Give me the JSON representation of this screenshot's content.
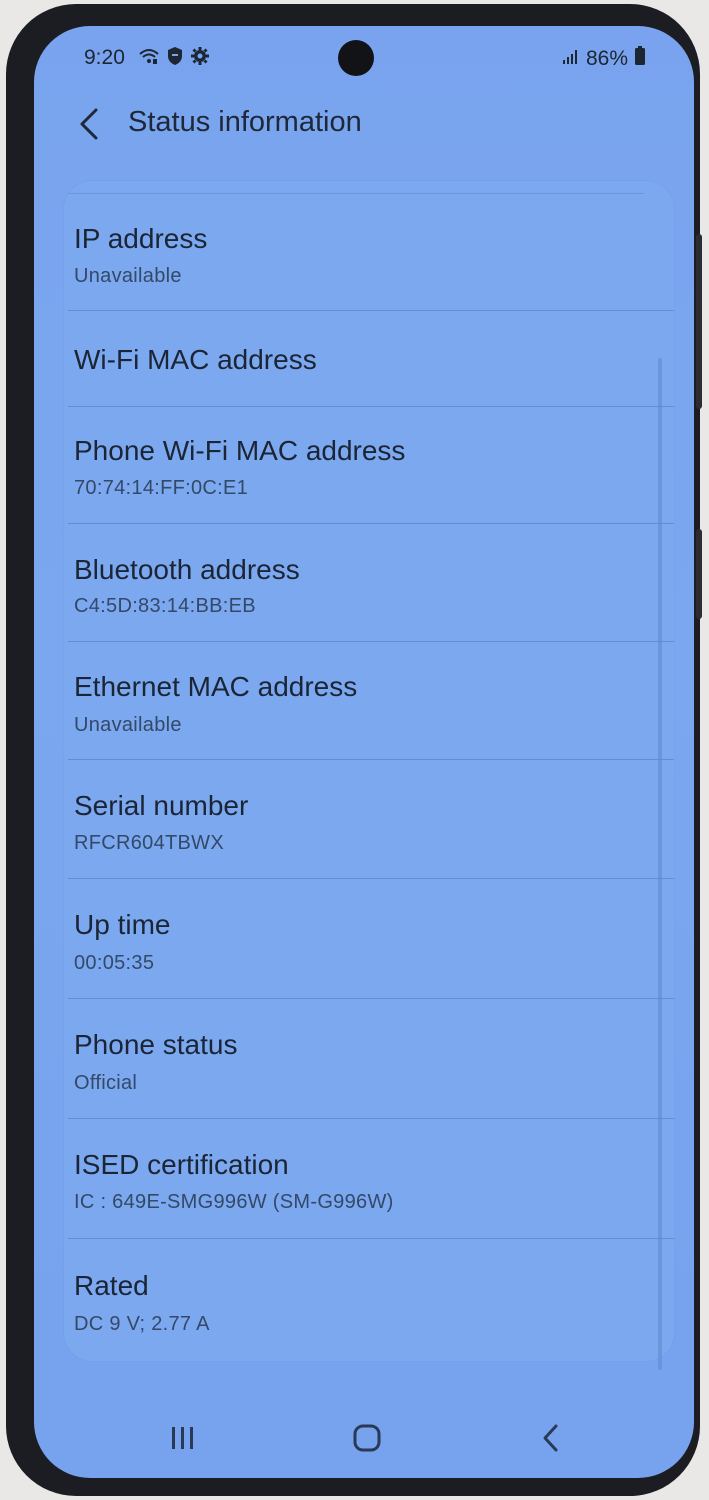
{
  "status_bar": {
    "time": "9:20",
    "battery": "86%",
    "icons": [
      "wifi-calling-icon",
      "shield-icon",
      "gear-icon"
    ],
    "right_icons": [
      "signal-icon",
      "battery-icon"
    ]
  },
  "app_bar": {
    "title": "Status information",
    "back_icon": "chevron-left-icon"
  },
  "items": [
    {
      "title": "IP address",
      "subtitle": "Unavailable"
    },
    {
      "title": "Wi-Fi MAC address",
      "subtitle": ""
    },
    {
      "title": "Phone Wi-Fi MAC address",
      "subtitle": "70:74:14:FF:0C:E1"
    },
    {
      "title": "Bluetooth address",
      "subtitle": "C4:5D:83:14:BB:EB"
    },
    {
      "title": "Ethernet MAC address",
      "subtitle": "Unavailable"
    },
    {
      "title": "Serial number",
      "subtitle": "RFCR604TBWX"
    },
    {
      "title": "Up time",
      "subtitle": "00:05:35"
    },
    {
      "title": "Phone status",
      "subtitle": "Official"
    },
    {
      "title": "ISED certification",
      "subtitle": "IC : 649E-SMG996W (SM-G996W)"
    },
    {
      "title": "Rated",
      "subtitle": "DC 9 V; 2.77 A"
    }
  ],
  "nav_bar": {
    "recents_icon": "recents-icon",
    "home_icon": "home-icon",
    "back_icon": "back-icon"
  },
  "colors": {
    "screen_background": "#79a3ee",
    "text_primary": "#1b2535",
    "text_secondary": "#334968"
  }
}
